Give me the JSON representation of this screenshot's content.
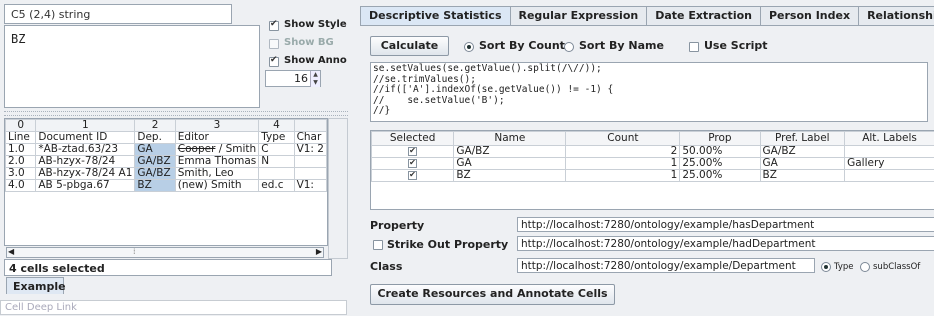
{
  "left": {
    "cell_info": "C5 (2,4) string",
    "cell_value": "BZ",
    "options": {
      "show_style": "Show Style",
      "show_bg": "Show BG",
      "show_anno": "Show Anno",
      "font_size": "16"
    },
    "grid": {
      "col_numbers": [
        "0",
        "1",
        "2",
        "3",
        "4"
      ],
      "headers": [
        "Line",
        "Document ID",
        "Dep.",
        "Editor",
        "Type",
        "Char"
      ],
      "rows": [
        [
          "1.0",
          "*AB-ztad.63/23",
          "GA",
          "Cooper",
          " / Smith",
          "C",
          "V1: 2"
        ],
        [
          "2.0",
          "AB-hzyx-78/24",
          "GA/BZ",
          "Emma Thomas",
          "",
          "N",
          ""
        ],
        [
          "3.0",
          "AB-hzyx-78/24 A1",
          "GA/BZ",
          "Smith, Leo",
          "",
          "",
          ""
        ],
        [
          "4.0",
          "AB 5-pbga.67",
          "BZ",
          "(new) Smith",
          "",
          "ed.c",
          "V1:"
        ]
      ]
    },
    "selection_status": "4 cells selected",
    "sheet_tab": "Example",
    "deep_link_placeholder": "Cell Deep Link"
  },
  "right": {
    "tabs": [
      "Descriptive Statistics",
      "Regular Expression",
      "Date Extraction",
      "Person Index",
      "Relationship Disc"
    ],
    "calculate_label": "Calculate",
    "sort_by_count": "Sort By Count",
    "sort_by_name": "Sort By Name",
    "use_script": "Use Script",
    "script_lines": [
      "se.setValues(se.getValue().split(/\\//));",
      "//se.trimValues();",
      "//if(['A'].indexOf(se.getValue()) != -1) {",
      "//    se.setValue('B');",
      "//}"
    ],
    "stats": {
      "headers": [
        "Selected",
        "Name",
        "Count",
        "Prop",
        "Pref. Label",
        "Alt. Labels"
      ],
      "rows": [
        {
          "name": "GA/BZ",
          "count": "2",
          "prop": "50.00%",
          "pref": "GA/BZ",
          "alt": ""
        },
        {
          "name": "GA",
          "count": "1",
          "prop": "25.00%",
          "pref": "GA",
          "alt": "Gallery"
        },
        {
          "name": "BZ",
          "count": "1",
          "prop": "25.00%",
          "pref": "BZ",
          "alt": ""
        }
      ]
    },
    "property_label": "Property",
    "property_value": "http://localhost:7280/ontology/example/hasDepartment",
    "strike_label": "Strike Out Property",
    "strike_value": "http://localhost:7280/ontology/example/hadDepartment",
    "class_label": "Class",
    "class_value": "http://localhost:7280/ontology/example/Department",
    "type_label": "Type",
    "subclass_label": "subClassOf",
    "create_label": "Create Resources and Annotate Cells"
  }
}
